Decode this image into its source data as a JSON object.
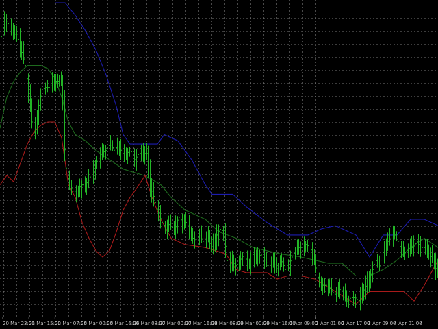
{
  "chart_data": {
    "type": "line",
    "background": "#000000",
    "grid": true,
    "grid_color": "#7a7a7a",
    "colors": {
      "price_bars": "#22b526",
      "upper_band": "#1c1cb0",
      "lower_band": "#a81a1a",
      "middle_line": "#1e6a1e",
      "tick_text": "#c8c8c8"
    },
    "x_tick_labels": [
      "20 Mar 23:00",
      "21 Mar 15:00",
      "22 Mar 07:00",
      "25 Mar 00:00",
      "25 Mar 16:00",
      "26 Mar 08:00",
      "27 Mar 00:00",
      "27 Mar 16:00",
      "28 Mar 08:00",
      "29 Mar 00:00",
      "29 Mar 16:00",
      "1 Apr 09:00",
      "2 Apr 01:00",
      "2 Apr 17:00",
      "3 Apr 09:00",
      "4 Apr 01:00",
      "4"
    ],
    "y_range": [
      0,
      100
    ],
    "y_units": "price (no axis values visible)",
    "price": [
      [
        0,
        88
      ],
      [
        6,
        95
      ],
      [
        12,
        93
      ],
      [
        18,
        90
      ],
      [
        24,
        90
      ],
      [
        30,
        85
      ],
      [
        36,
        80
      ],
      [
        42,
        70
      ],
      [
        48,
        58
      ],
      [
        54,
        65
      ],
      [
        60,
        72
      ],
      [
        66,
        73
      ],
      [
        72,
        73
      ],
      [
        78,
        75
      ],
      [
        84,
        75
      ],
      [
        90,
        75
      ],
      [
        94,
        50
      ],
      [
        100,
        42
      ],
      [
        106,
        40
      ],
      [
        112,
        40
      ],
      [
        118,
        42
      ],
      [
        124,
        42
      ],
      [
        130,
        44
      ],
      [
        136,
        47
      ],
      [
        142,
        50
      ],
      [
        148,
        52
      ],
      [
        154,
        53
      ],
      [
        160,
        55
      ],
      [
        166,
        53
      ],
      [
        172,
        55
      ],
      [
        178,
        52
      ],
      [
        184,
        52
      ],
      [
        190,
        53
      ],
      [
        196,
        50
      ],
      [
        202,
        52
      ],
      [
        208,
        52
      ],
      [
        214,
        52
      ],
      [
        218,
        42
      ],
      [
        224,
        38
      ],
      [
        230,
        33
      ],
      [
        236,
        30
      ],
      [
        242,
        28
      ],
      [
        248,
        30
      ],
      [
        254,
        27
      ],
      [
        260,
        32
      ],
      [
        266,
        30
      ],
      [
        272,
        30
      ],
      [
        278,
        26
      ],
      [
        284,
        24
      ],
      [
        290,
        26
      ],
      [
        296,
        24
      ],
      [
        302,
        26
      ],
      [
        308,
        22
      ],
      [
        314,
        25
      ],
      [
        320,
        28
      ],
      [
        326,
        27
      ],
      [
        332,
        16
      ],
      [
        338,
        18
      ],
      [
        344,
        16
      ],
      [
        350,
        18
      ],
      [
        356,
        20
      ],
      [
        362,
        16
      ],
      [
        368,
        20
      ],
      [
        374,
        18
      ],
      [
        380,
        20
      ],
      [
        386,
        18
      ],
      [
        392,
        16
      ],
      [
        398,
        18
      ],
      [
        404,
        15
      ],
      [
        410,
        18
      ],
      [
        416,
        15
      ],
      [
        422,
        17
      ],
      [
        428,
        20
      ],
      [
        434,
        22
      ],
      [
        440,
        22
      ],
      [
        446,
        23
      ],
      [
        452,
        22
      ],
      [
        458,
        19
      ],
      [
        464,
        12
      ],
      [
        470,
        10
      ],
      [
        476,
        10
      ],
      [
        482,
        9
      ],
      [
        488,
        7
      ],
      [
        494,
        9
      ],
      [
        500,
        8
      ],
      [
        506,
        5
      ],
      [
        512,
        6
      ],
      [
        518,
        6
      ],
      [
        524,
        5
      ],
      [
        530,
        8
      ],
      [
        536,
        11
      ],
      [
        542,
        14
      ],
      [
        548,
        18
      ],
      [
        554,
        16
      ],
      [
        560,
        22
      ],
      [
        566,
        24
      ],
      [
        572,
        26
      ],
      [
        578,
        26
      ],
      [
        584,
        22
      ],
      [
        590,
        20
      ],
      [
        596,
        22
      ],
      [
        602,
        22
      ],
      [
        608,
        24
      ],
      [
        614,
        22
      ],
      [
        620,
        22
      ],
      [
        626,
        20
      ],
      [
        632,
        18
      ],
      [
        638,
        14
      ]
    ],
    "upper_band": [
      [
        80,
        100
      ],
      [
        95,
        100
      ],
      [
        110,
        96
      ],
      [
        125,
        91
      ],
      [
        140,
        85
      ],
      [
        155,
        77
      ],
      [
        170,
        67
      ],
      [
        180,
        58
      ],
      [
        190,
        55
      ],
      [
        230,
        55
      ],
      [
        240,
        58
      ],
      [
        260,
        56
      ],
      [
        280,
        50
      ],
      [
        300,
        42
      ],
      [
        310,
        39
      ],
      [
        340,
        39
      ],
      [
        360,
        35
      ],
      [
        390,
        30
      ],
      [
        420,
        26
      ],
      [
        450,
        26
      ],
      [
        470,
        28
      ],
      [
        490,
        29
      ],
      [
        520,
        26
      ],
      [
        540,
        19
      ],
      [
        560,
        26
      ],
      [
        580,
        26
      ],
      [
        600,
        31
      ],
      [
        620,
        31
      ],
      [
        640,
        29
      ]
    ],
    "lower_band": [
      [
        0,
        42
      ],
      [
        10,
        45
      ],
      [
        20,
        43
      ],
      [
        30,
        49
      ],
      [
        40,
        55
      ],
      [
        50,
        59
      ],
      [
        60,
        61
      ],
      [
        70,
        62
      ],
      [
        80,
        62
      ],
      [
        90,
        57
      ],
      [
        100,
        42
      ],
      [
        110,
        38
      ],
      [
        120,
        30
      ],
      [
        130,
        25
      ],
      [
        140,
        21
      ],
      [
        150,
        19
      ],
      [
        160,
        21
      ],
      [
        170,
        27
      ],
      [
        180,
        34
      ],
      [
        190,
        38
      ],
      [
        200,
        41
      ],
      [
        212,
        45
      ],
      [
        222,
        38
      ],
      [
        235,
        31
      ],
      [
        250,
        25
      ],
      [
        270,
        23
      ],
      [
        300,
        22
      ],
      [
        330,
        20
      ],
      [
        345,
        15
      ],
      [
        360,
        14
      ],
      [
        390,
        14
      ],
      [
        405,
        12
      ],
      [
        420,
        13
      ],
      [
        440,
        13
      ],
      [
        460,
        12
      ],
      [
        475,
        10
      ],
      [
        490,
        8
      ],
      [
        505,
        6
      ],
      [
        520,
        4
      ],
      [
        540,
        8
      ],
      [
        570,
        8
      ],
      [
        590,
        8
      ],
      [
        605,
        5
      ],
      [
        620,
        10
      ],
      [
        640,
        18
      ]
    ],
    "middle_line": [
      [
        0,
        60
      ],
      [
        10,
        70
      ],
      [
        20,
        75
      ],
      [
        30,
        78
      ],
      [
        40,
        80
      ],
      [
        50,
        80
      ],
      [
        60,
        80
      ],
      [
        70,
        79
      ],
      [
        80,
        76
      ],
      [
        90,
        70
      ],
      [
        100,
        62
      ],
      [
        110,
        58
      ],
      [
        125,
        56
      ],
      [
        140,
        53
      ],
      [
        160,
        50
      ],
      [
        180,
        47
      ],
      [
        195,
        46
      ],
      [
        210,
        45
      ],
      [
        220,
        44
      ],
      [
        235,
        42
      ],
      [
        250,
        38
      ],
      [
        270,
        34
      ],
      [
        300,
        31
      ],
      [
        320,
        27
      ],
      [
        345,
        25
      ],
      [
        370,
        22
      ],
      [
        390,
        21
      ],
      [
        410,
        20
      ],
      [
        440,
        19
      ],
      [
        460,
        18
      ],
      [
        480,
        17
      ],
      [
        500,
        17
      ],
      [
        520,
        13
      ],
      [
        540,
        13
      ],
      [
        560,
        15
      ],
      [
        580,
        18
      ],
      [
        600,
        22
      ],
      [
        620,
        25
      ],
      [
        640,
        22
      ]
    ]
  }
}
